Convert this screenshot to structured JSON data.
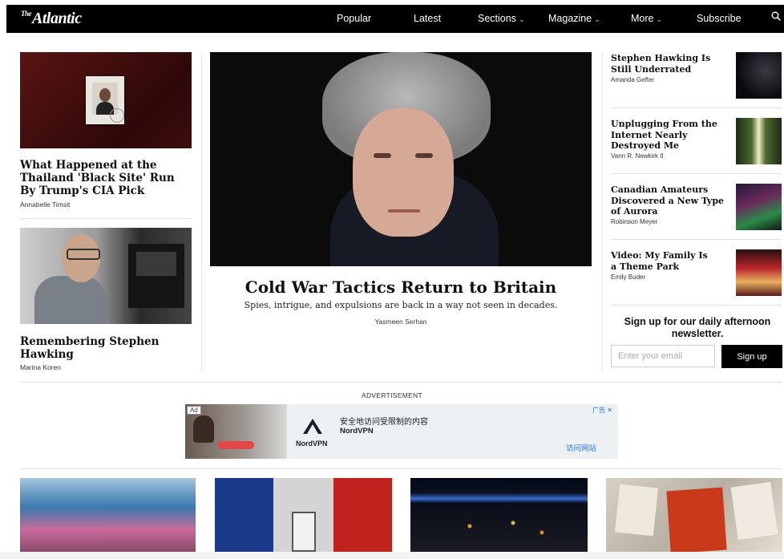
{
  "nav": {
    "logo_prefix": "The",
    "logo": "Atlantic",
    "items": [
      {
        "label": "Popular",
        "has_menu": false
      },
      {
        "label": "Latest",
        "has_menu": false
      },
      {
        "label": "Sections",
        "has_menu": true
      },
      {
        "label": "Magazine",
        "has_menu": true
      },
      {
        "label": "More",
        "has_menu": true
      },
      {
        "label": "Subscribe",
        "has_menu": false
      }
    ],
    "search_icon": "search-icon"
  },
  "left_stories": [
    {
      "title": "What Happened at the Thailand 'Black Site' Run By Trump's CIA Pick",
      "author": "Annabelle Timsit"
    },
    {
      "title": "Remembering Stephen Hawking",
      "author": "Marina Koren"
    }
  ],
  "feature": {
    "title": "Cold War Tactics Return to Britain",
    "subtitle": "Spies, intrigue, and expulsions are back in a way not seen in decades.",
    "author": "Yasmeen Serhan"
  },
  "right_stories": [
    {
      "title": "Stephen Hawking Is Still Underrated",
      "author": "Amanda Gefter"
    },
    {
      "title": "Unplugging From the Internet Nearly Destroyed Me",
      "author": "Vann R. Newkirk II"
    },
    {
      "title": "Canadian Amateurs Discovered a New Type of Aurora",
      "author": "Robinson Meyer"
    },
    {
      "title": "Video: My Family Is a Theme Park",
      "author": "Emily Buder"
    }
  ],
  "newsletter": {
    "title": "Sign up for our daily afternoon newsletter.",
    "placeholder": "Enter your email",
    "button": "Sign up"
  },
  "ad": {
    "section_label": "ADVERTISEMENT",
    "badge": "Ad",
    "headline": "安全地访问受限制的内容",
    "brand": "NordVPN",
    "logo_text": "NordVPN",
    "cta": "访问网站",
    "choices": "广告"
  },
  "colors": {
    "nav_bg": "#000000",
    "button_bg": "#000000",
    "ad_bg": "#eef1f3",
    "ad_cta": "#1a73e8"
  }
}
